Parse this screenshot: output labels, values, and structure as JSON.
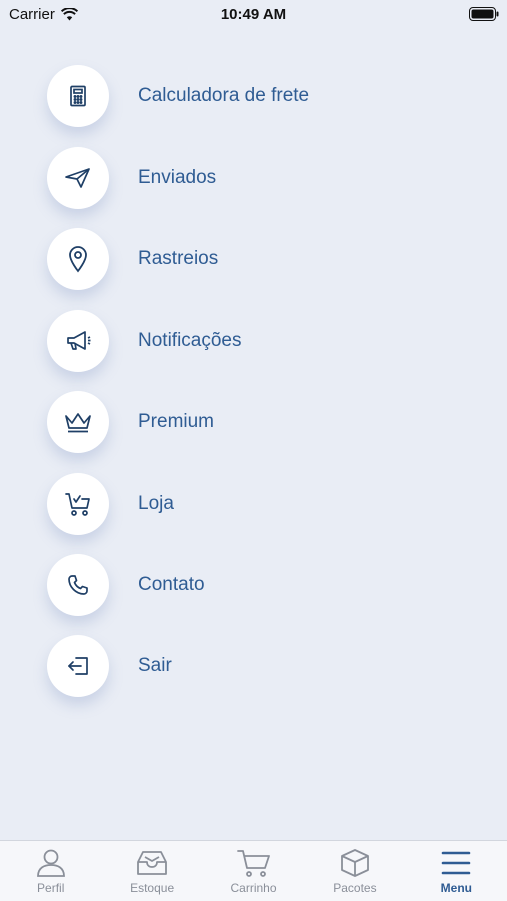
{
  "status_bar": {
    "carrier": "Carrier",
    "time": "10:49 AM"
  },
  "menu": {
    "items": [
      {
        "label": "Calculadora de frete",
        "icon": "calculator-icon"
      },
      {
        "label": "Enviados",
        "icon": "paper-plane-icon"
      },
      {
        "label": "Rastreios",
        "icon": "location-pin-icon"
      },
      {
        "label": "Notificações",
        "icon": "megaphone-icon"
      },
      {
        "label": "Premium",
        "icon": "crown-icon"
      },
      {
        "label": "Loja",
        "icon": "shopping-cart-check-icon"
      },
      {
        "label": "Contato",
        "icon": "phone-icon"
      },
      {
        "label": "Sair",
        "icon": "logout-icon"
      }
    ]
  },
  "tab_bar": {
    "active": "Menu",
    "tabs": [
      {
        "label": "Perfil",
        "icon": "user-icon"
      },
      {
        "label": "Estoque",
        "icon": "inbox-tray-icon"
      },
      {
        "label": "Carrinho",
        "icon": "cart-icon"
      },
      {
        "label": "Pacotes",
        "icon": "package-box-icon"
      },
      {
        "label": "Menu",
        "icon": "hamburger-menu-icon"
      }
    ]
  },
  "colors": {
    "background": "#e9edf5",
    "accent": "#2f5c93",
    "icon": "#1f3f66",
    "tab_inactive": "#8a8f99"
  }
}
